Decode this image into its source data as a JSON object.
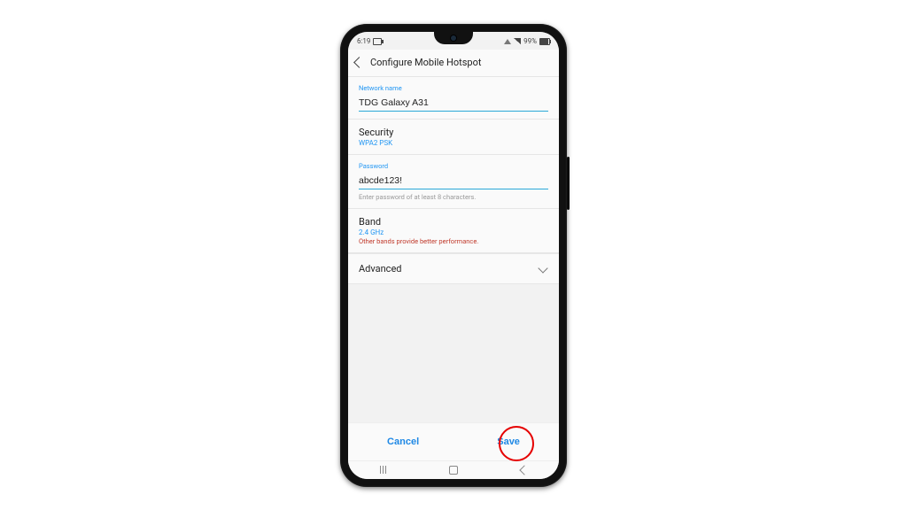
{
  "statusbar": {
    "time": "6:19",
    "battery_text": "99%"
  },
  "header": {
    "title": "Configure Mobile Hotspot"
  },
  "fields": {
    "network_name": {
      "label": "Network name",
      "value": "TDG Galaxy A31"
    },
    "security": {
      "label": "Security",
      "value": "WPA2 PSK"
    },
    "password": {
      "label": "Password",
      "value": "abcde123!",
      "helper": "Enter password of at least 8 characters."
    },
    "band": {
      "label": "Band",
      "value": "2.4 GHz",
      "warning": "Other bands provide better performance."
    },
    "advanced": {
      "label": "Advanced"
    }
  },
  "actions": {
    "cancel": "Cancel",
    "save": "Save"
  }
}
